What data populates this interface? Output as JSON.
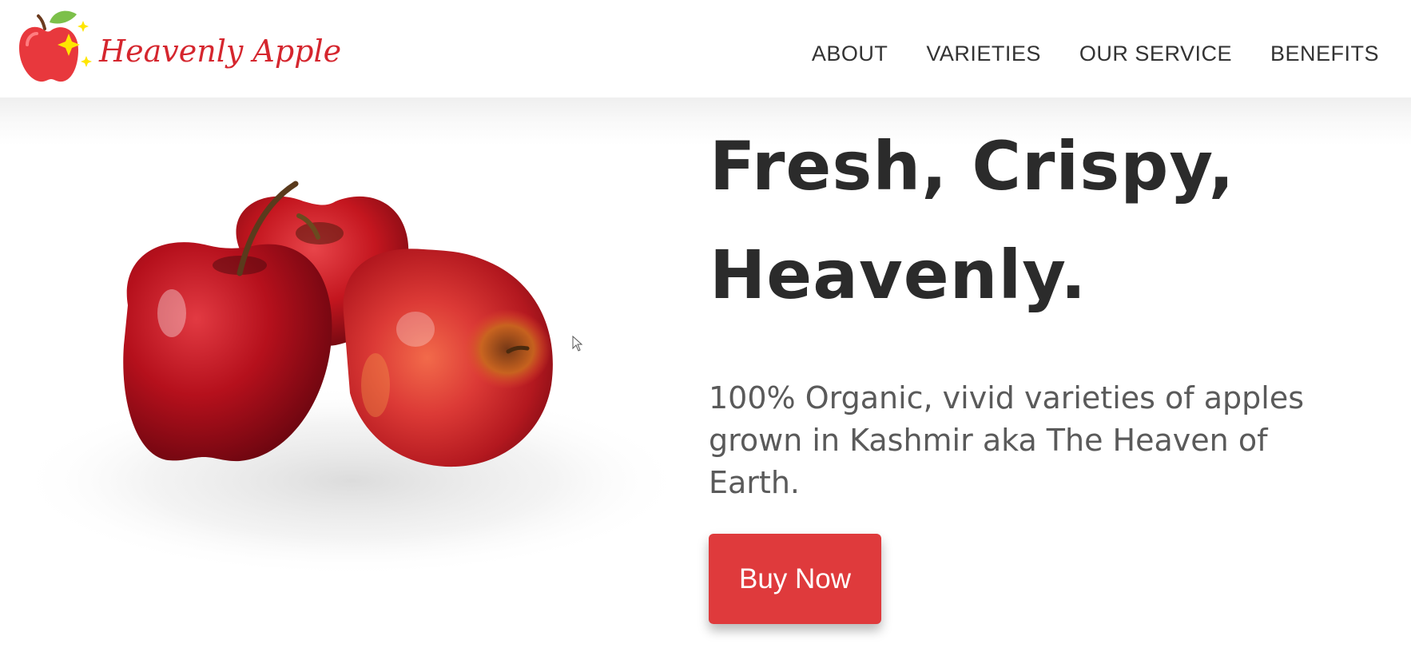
{
  "brand": {
    "name": "Heavenly Apple",
    "logo_icon": "apple-sparkle-icon"
  },
  "nav": {
    "items": [
      {
        "label": "ABOUT"
      },
      {
        "label": "VARIETIES"
      },
      {
        "label": "OUR SERVICE"
      },
      {
        "label": "BENEFITS"
      }
    ]
  },
  "hero": {
    "headline_line1": "Fresh, Crispy,",
    "headline_line2": "Heavenly.",
    "subtext": "100% Organic, vivid varieties of apples grown in Kashmir aka The Heaven of Earth.",
    "cta_label": "Buy Now"
  },
  "colors": {
    "brand_red": "#d5262e",
    "button_red": "#df3a3c",
    "heading_text": "#2b2b2b",
    "body_text": "#5a5a5a",
    "nav_text": "#333333"
  }
}
